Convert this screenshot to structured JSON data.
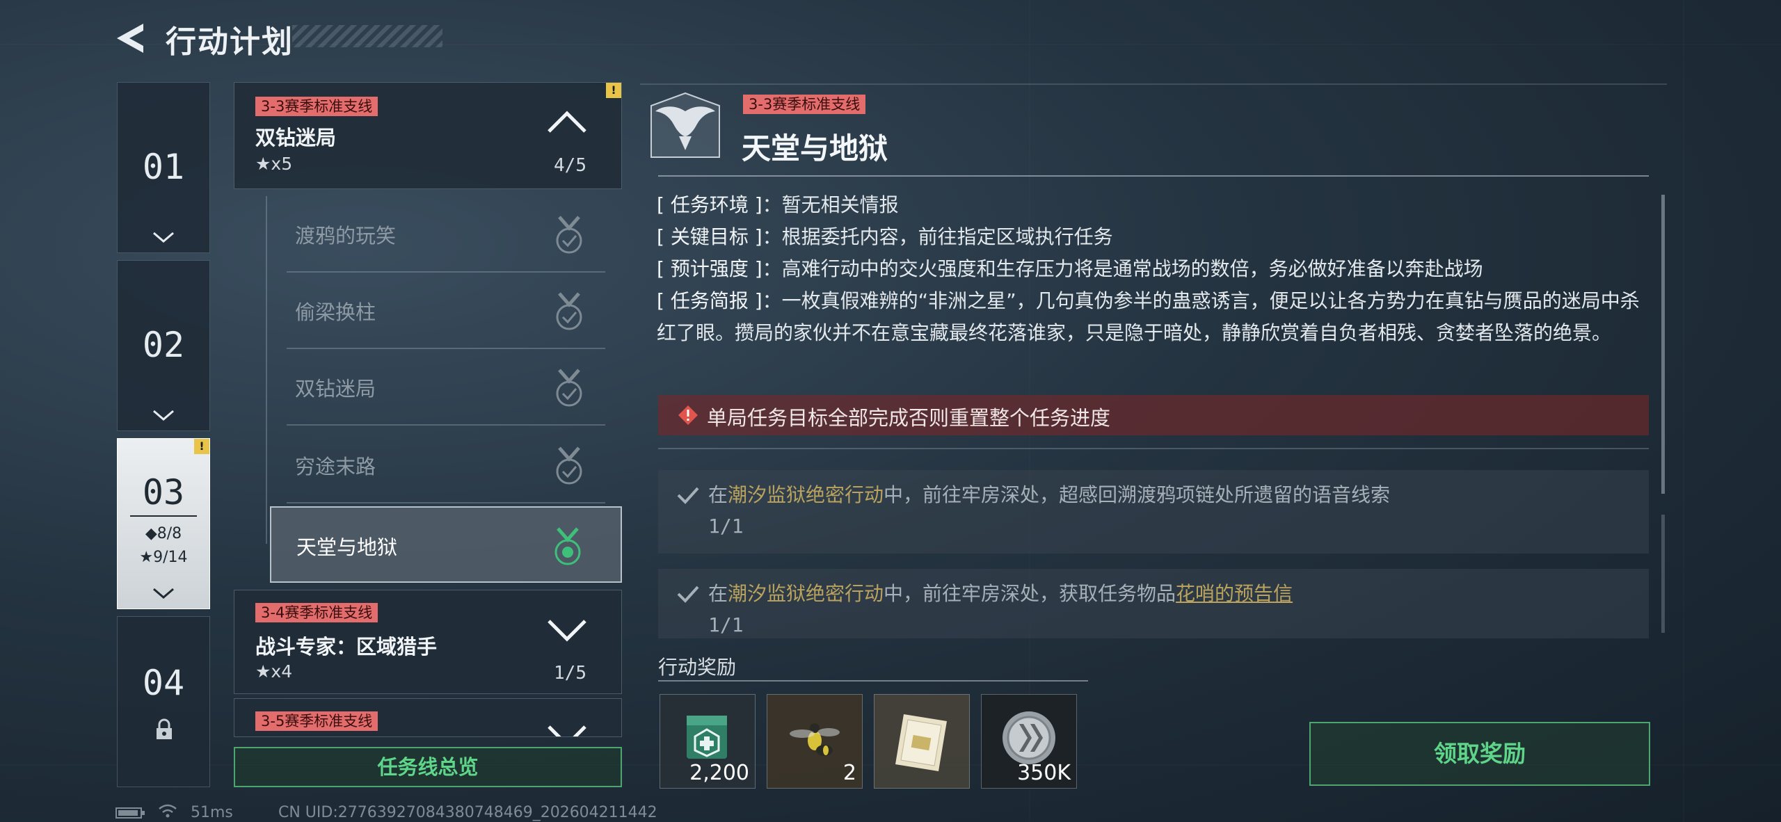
{
  "header": {
    "title": "行动计划"
  },
  "chapters": [
    {
      "num": "01"
    },
    {
      "num": "02"
    },
    {
      "num": "03",
      "diamond_stat": "◆8/8",
      "star_stat": "★9/14",
      "badge": "!"
    },
    {
      "num": "04"
    }
  ],
  "missions": [
    {
      "tag": "3-3赛季标准支线",
      "name": "双钻迷局",
      "stars": "★x5",
      "progress": "4/5",
      "badge": "!"
    },
    {
      "tag": "3-4赛季标准支线",
      "name": "战斗专家：区域猎手",
      "stars": "★x4",
      "progress": "1/5"
    },
    {
      "tag": "3-5赛季标准支线"
    }
  ],
  "sub_missions": [
    "渡鸦的玩笑",
    "偷梁换柱",
    "双钻迷局",
    "穷途末路",
    "天堂与地狱"
  ],
  "overview_button": "任务线总览",
  "detail": {
    "tag": "3-3赛季标准支线",
    "title": "天堂与地狱",
    "info": [
      {
        "key": "[ 任务环境 ]",
        "value": "暂无相关情报"
      },
      {
        "key": "[ 关键目标 ]",
        "value": "根据委托内容，前往指定区域执行任务"
      },
      {
        "key": "[ 预计强度 ]",
        "value": "高难行动中的交火强度和生存压力将是通常战场的数倍，务必做好准备以奔赴战场"
      },
      {
        "key": "[ 任务简报 ]",
        "value": "一枚真假难辨的“非洲之星”，几句真伪参半的蛊惑诱言，便足以让各方势力在真钻与赝品的迷局中杀红了眼。攒局的家伙并不在意宝藏最终花落谁家，只是隐于暗处，静静欣赏着自负者相残、贪婪者坠落的绝景。"
      }
    ],
    "sep": "：",
    "warning": "单局任务目标全部完成否则重置整个任务进度",
    "objectives": [
      {
        "pre": "在",
        "place": "潮汐监狱绝密行动",
        "mid": "中，前往牢房深处，超感回溯渡鸦项链处所遗留的语音线索",
        "item": "",
        "count": "1/1"
      },
      {
        "pre": "在",
        "place": "潮汐监狱绝密行动",
        "mid": "中，前往牢房深处，获取任务物品",
        "item": "花哨的预告信",
        "count": "1/1"
      }
    ]
  },
  "rewards": {
    "label": "行动奖励",
    "items": [
      {
        "icon": "medkit-case-icon",
        "qty": "2,200"
      },
      {
        "icon": "wasp-icon",
        "qty": "2"
      },
      {
        "icon": "document-icon",
        "qty": ""
      },
      {
        "icon": "coin-icon",
        "qty": "350K"
      }
    ]
  },
  "claim_button": "领取奖励",
  "status_bar": {
    "ping": "51ms",
    "uid": "CN UID:27763927084380748469_202604211442"
  },
  "colors": {
    "accent_green": "#5fd58a",
    "tag_red": "#e36d6d",
    "highlight_gold": "#b9a35e",
    "warning_yellow": "#e8c548"
  }
}
